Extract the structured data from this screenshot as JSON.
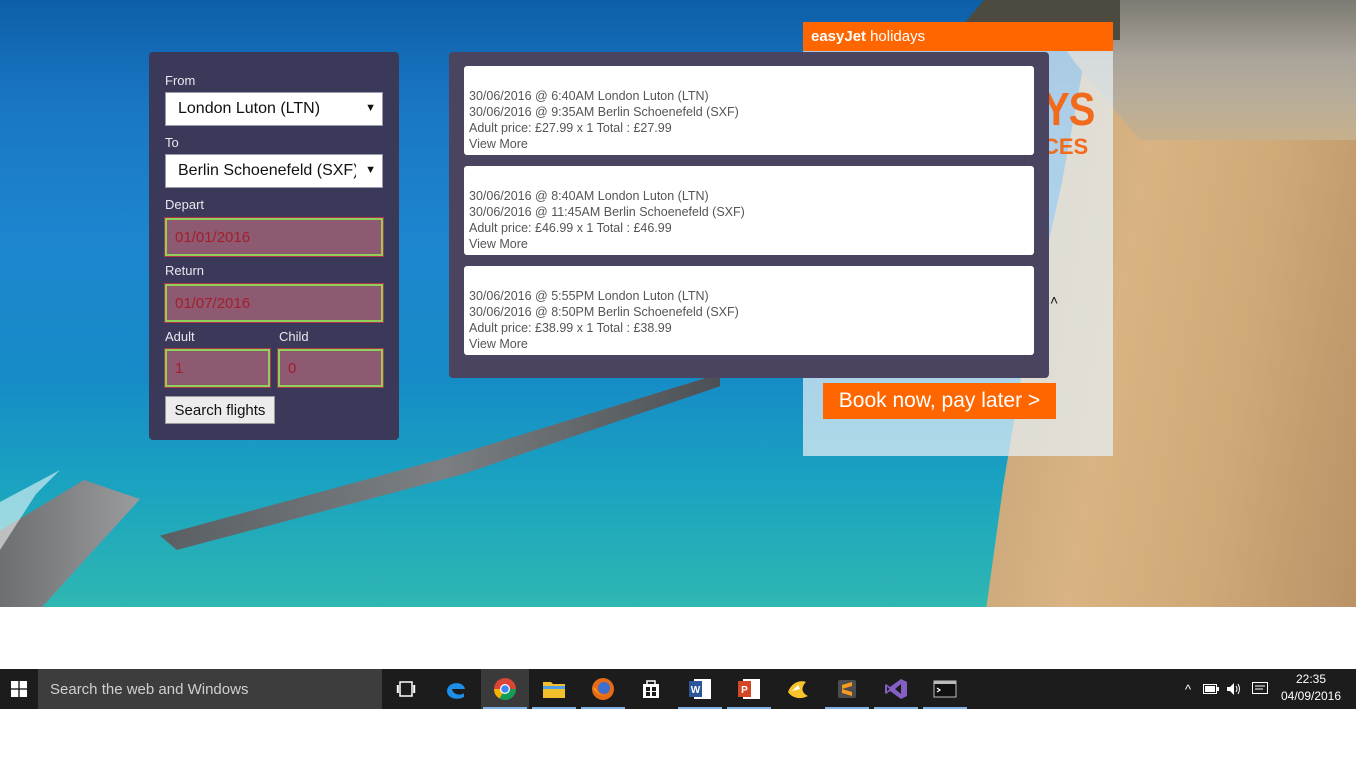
{
  "search": {
    "from_label": "From",
    "from_value": "London Luton (LTN)",
    "to_label": "To",
    "to_value": "Berlin Schoenefeld (SXF)",
    "depart_label": "Depart",
    "depart_value": "01/01/2016",
    "return_label": "Return",
    "return_value": "01/07/2016",
    "adult_label": "Adult",
    "adult_value": "1",
    "child_label": "Child",
    "child_value": "0",
    "button_label": "Search flights"
  },
  "results": [
    {
      "depart": "30/06/2016 @ 6:40AM London Luton (LTN)",
      "arrive": "30/06/2016 @ 9:35AM Berlin Schoenefeld (SXF)",
      "price": "Adult price: £27.99 x 1 Total : £27.99",
      "more": "View More"
    },
    {
      "depart": "30/06/2016 @ 8:40AM London Luton (LTN)",
      "arrive": "30/06/2016 @ 11:45AM Berlin Schoenefeld (SXF)",
      "price": "Adult price: £46.99 x 1 Total : £46.99",
      "more": "View More"
    },
    {
      "depart": "30/06/2016 @ 5:55PM London Luton (LTN)",
      "arrive": "30/06/2016 @ 8:50PM Berlin Schoenefeld (SXF)",
      "price": "Adult price: £38.99 x 1 Total : £38.99",
      "more": "View More"
    }
  ],
  "ad": {
    "brand": "easyJet",
    "brand_suffix": "holidays",
    "fragment_1": "YS",
    "fragment_2": "CES",
    "cta": "Book now, pay later >",
    "caret": "˄"
  },
  "taskbar": {
    "search_placeholder": "Search the web and Windows",
    "time": "22:35",
    "date": "04/09/2016",
    "tray_up": "^",
    "icons": [
      "task-view-icon",
      "edge-icon",
      "chrome-icon",
      "file-explorer-icon",
      "firefox-icon",
      "store-icon",
      "word-icon",
      "powerpoint-icon",
      "sketch-icon",
      "sublime-icon",
      "visual-studio-icon",
      "terminal-icon"
    ]
  },
  "colors": {
    "accent": "#ff6600",
    "panel": "#3b3959",
    "results_panel": "#4a4460",
    "invalid_text": "#a61d2c"
  }
}
